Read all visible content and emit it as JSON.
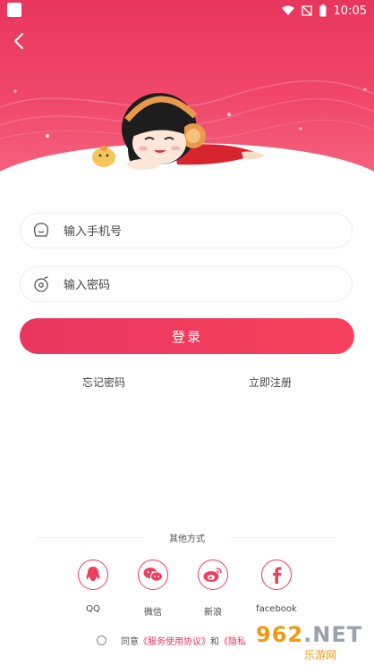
{
  "status_bar": {
    "time": "10:05"
  },
  "login": {
    "phone_placeholder": "输入手机号",
    "password_placeholder": "输入密码",
    "login_button": "登录",
    "forgot_password": "忘记密码",
    "register": "立即注册"
  },
  "other": {
    "title": "其他方式",
    "methods": [
      {
        "label": "QQ",
        "icon": "qq-icon"
      },
      {
        "label": "微信",
        "icon": "wechat-icon"
      },
      {
        "label": "新浪",
        "icon": "weibo-icon"
      },
      {
        "label": "facebook",
        "icon": "facebook-icon"
      }
    ]
  },
  "agreement": {
    "agree": "同意",
    "terms": "《服务使用协议》",
    "and": "和",
    "privacy": "《隐私"
  },
  "watermark": {
    "logo_main": "962",
    "logo_suffix": ".NET",
    "sub": "乐游网"
  },
  "colors": {
    "accent": "#e8365e",
    "accent_light": "#f7415d",
    "text": "#444444"
  }
}
